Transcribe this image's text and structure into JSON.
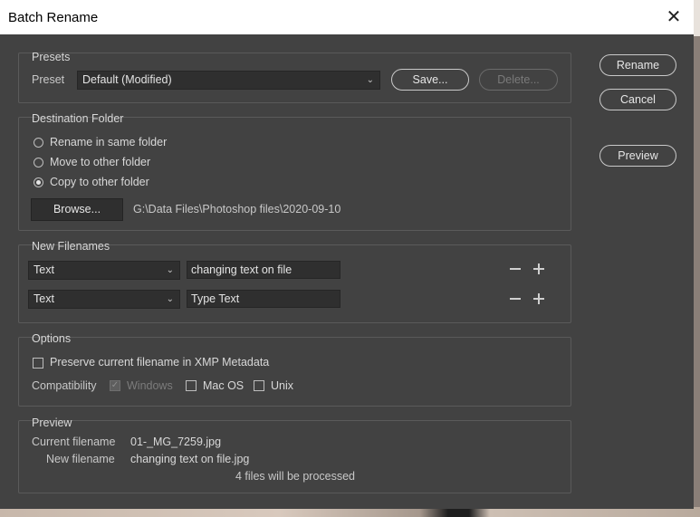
{
  "window": {
    "title": "Batch Rename",
    "close_glyph": "✕"
  },
  "presets": {
    "group_title": "Presets",
    "preset_label": "Preset",
    "preset_value": "Default (Modified)",
    "save_label": "Save...",
    "delete_label": "Delete..."
  },
  "side_buttons": {
    "rename": "Rename",
    "cancel": "Cancel",
    "preview": "Preview"
  },
  "destination": {
    "group_title": "Destination Folder",
    "options": [
      {
        "label": "Rename in same folder",
        "checked": false
      },
      {
        "label": "Move to other folder",
        "checked": false
      },
      {
        "label": "Copy to other folder",
        "checked": true
      }
    ],
    "browse_label": "Browse...",
    "path": "G:\\Data Files\\Photoshop files\\2020-09-10"
  },
  "new_filenames": {
    "group_title": "New Filenames",
    "rows": [
      {
        "type": "Text",
        "value": "changing text  on file"
      },
      {
        "type": "Text",
        "value": "Type Text"
      }
    ],
    "minus_icon": "minus-icon",
    "plus_icon": "plus-icon"
  },
  "options": {
    "group_title": "Options",
    "preserve_label": "Preserve current filename in XMP Metadata",
    "preserve_checked": false,
    "compatibility_label": "Compatibility",
    "windows_label": "Windows",
    "windows_checked": true,
    "macos_label": "Mac OS",
    "macos_checked": false,
    "unix_label": "Unix",
    "unix_checked": false
  },
  "preview": {
    "group_title": "Preview",
    "current_label": "Current filename",
    "current_value": "01-_MG_7259.jpg",
    "new_label": "New filename",
    "new_value": "changing text  on file.jpg",
    "count_text": "4 files will be processed"
  }
}
